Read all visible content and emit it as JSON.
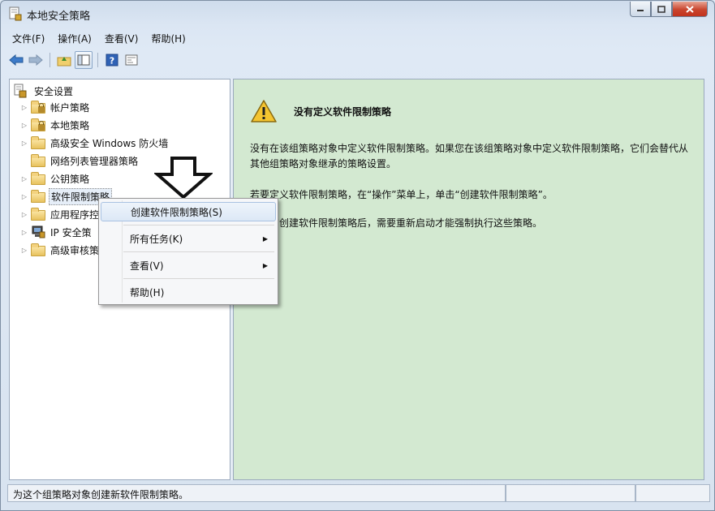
{
  "window": {
    "title": "本地安全策略"
  },
  "menubar": {
    "items": [
      "文件(F)",
      "操作(A)",
      "查看(V)",
      "帮助(H)"
    ]
  },
  "toolbar": {
    "icons": [
      "back-icon",
      "forward-icon",
      "up-folder-icon",
      "show-tree-icon",
      "help-icon",
      "properties-icon"
    ]
  },
  "tree": {
    "root": "安全设置",
    "items": [
      {
        "label": "帐户策略",
        "icon": "folder-lock-icon",
        "expandable": true
      },
      {
        "label": "本地策略",
        "icon": "folder-lock-icon",
        "expandable": true
      },
      {
        "label": "高级安全 Windows 防火墙",
        "icon": "folder-icon",
        "expandable": true
      },
      {
        "label": "网络列表管理器策略",
        "icon": "folder-icon",
        "expandable": false
      },
      {
        "label": "公钥策略",
        "icon": "folder-icon",
        "expandable": true
      },
      {
        "label": "软件限制策略",
        "icon": "folder-icon",
        "expandable": true,
        "selected": true
      },
      {
        "label": "应用程序控",
        "icon": "folder-icon",
        "expandable": true
      },
      {
        "label": "IP 安全策",
        "icon": "ip-security-icon",
        "expandable": true
      },
      {
        "label": "高级审核策",
        "icon": "folder-icon",
        "expandable": true
      }
    ]
  },
  "detail": {
    "heading": "没有定义软件限制策略",
    "para1": "没有在该组策略对象中定义软件限制策略。如果您在该组策略对象中定义软件限制策略，它们会替代从其他组策略对象继承的策略设置。",
    "para2": "若要定义软件限制策略，在“操作”菜单上，单击“创建软件限制策略”。",
    "para3": "在最初创建软件限制策略后，需要重新启动才能强制执行这些策略。"
  },
  "context_menu": {
    "items": [
      {
        "label": "创建软件限制策略(S)",
        "submenu": false
      },
      {
        "label": "所有任务(K)",
        "submenu": true
      },
      {
        "label": "查看(V)",
        "submenu": true
      },
      {
        "label": "帮助(H)",
        "submenu": false
      }
    ]
  },
  "statusbar": {
    "text": "为这个组策略对象创建新软件限制策略。"
  }
}
